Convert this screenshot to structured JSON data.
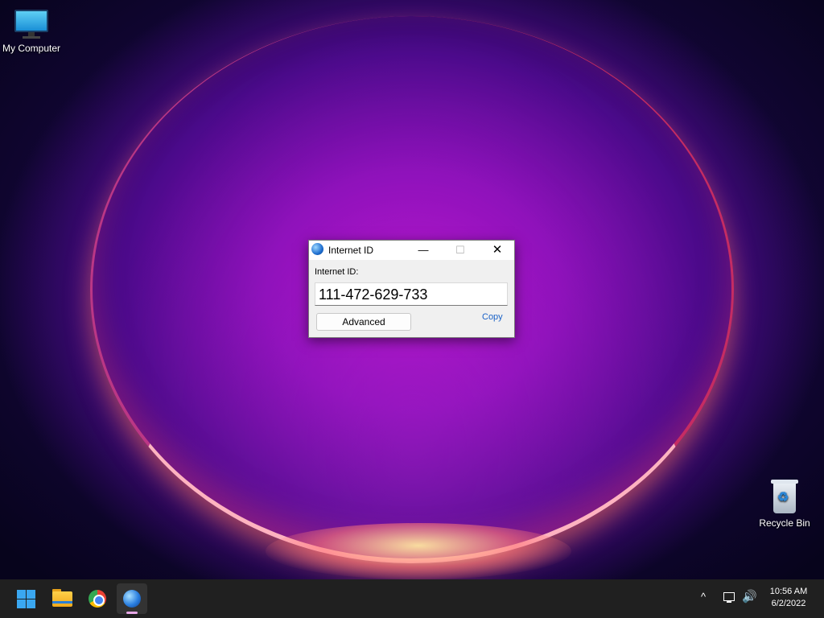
{
  "desktop": {
    "icons": [
      {
        "label": "My Computer",
        "icon": "monitor-icon"
      },
      {
        "label": "Recycle Bin",
        "icon": "recycle-bin-icon"
      }
    ]
  },
  "window": {
    "title": "Internet ID",
    "icon": "globe-icon",
    "minimize_glyph": "—",
    "maximize_glyph": "☐",
    "close_glyph": "✕",
    "field_label": "Internet ID:",
    "internet_id": "111-472-629-733",
    "advanced_label": "Advanced",
    "copy_label": "Copy"
  },
  "taskbar": {
    "apps": [
      "start-icon",
      "file-explorer-icon",
      "chrome-icon",
      "internet-id-app-icon"
    ],
    "tray_arrow": "^",
    "volume_glyph": "🔊",
    "time": "10:56 AM",
    "date": "6/2/2022"
  },
  "colors": {
    "accent_link": "#1a62c7",
    "taskbar_bg": "#202020",
    "wallpaper_primary": "#8a0fb8"
  }
}
